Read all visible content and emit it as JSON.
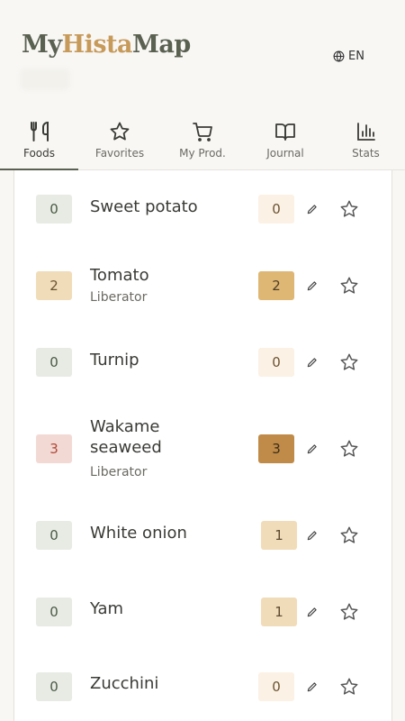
{
  "app": {
    "logo_parts": [
      "My",
      "Hista",
      "Map"
    ],
    "language": "EN",
    "globe_icon": "globe-icon"
  },
  "tabs": [
    {
      "label": "Foods",
      "icon": "fork-knife-icon",
      "active": true
    },
    {
      "label": "Favorites",
      "icon": "star-icon",
      "active": false
    },
    {
      "label": "My Prod.",
      "icon": "cart-icon",
      "active": false
    },
    {
      "label": "Journal",
      "icon": "book-icon",
      "active": false
    },
    {
      "label": "Stats",
      "icon": "bar-chart-icon",
      "active": false
    }
  ],
  "foods": [
    {
      "name": "Sweet potato",
      "score": "0",
      "rating": "0",
      "brand": ""
    },
    {
      "name": "Tomato",
      "score": "2",
      "rating": "2",
      "brand": "Liberator"
    },
    {
      "name": "Turnip",
      "score": "0",
      "rating": "0",
      "brand": ""
    },
    {
      "name": "Wakame seaweed",
      "score": "3",
      "rating": "3",
      "brand": "Liberator"
    },
    {
      "name": "White onion",
      "score": "0",
      "rating": "1",
      "brand": ""
    },
    {
      "name": "Yam",
      "score": "0",
      "rating": "1",
      "brand": ""
    },
    {
      "name": "Zucchini",
      "score": "0",
      "rating": "0",
      "brand": ""
    }
  ],
  "colors": {
    "brand_green": "#5a6151",
    "brand_gold": "#c79a5a",
    "score_0": "#e8ebe4",
    "score_2": "#f0dcb8",
    "score_3": "#f2d9d4",
    "rating_0": "#fbf1e4",
    "rating_1": "#f1dcba",
    "rating_2": "#dfb774",
    "rating_3": "#c08b48"
  }
}
